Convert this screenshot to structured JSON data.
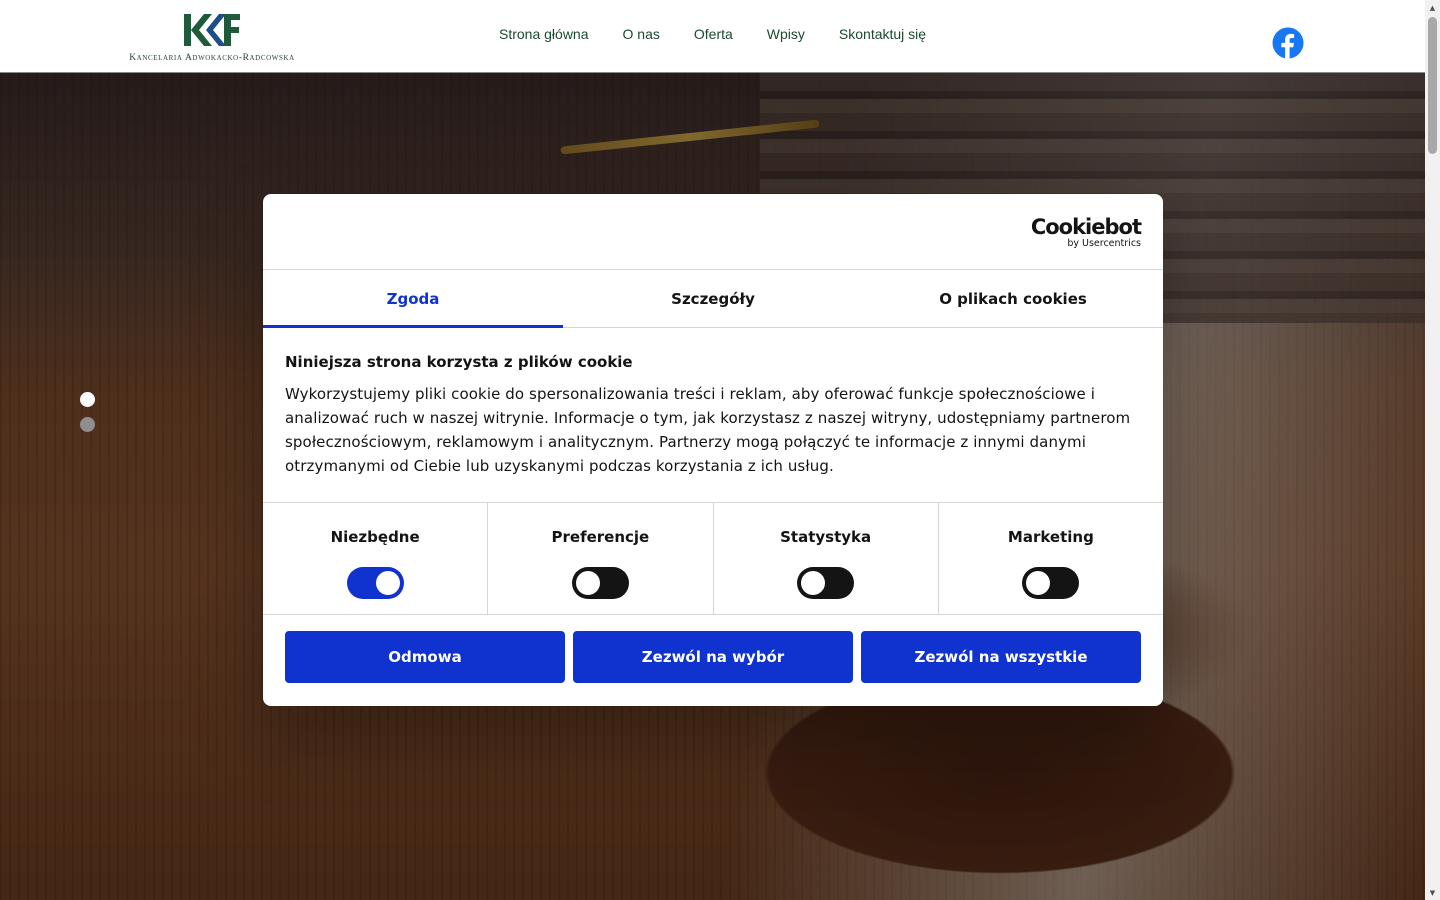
{
  "header": {
    "logo_initials": "KKF",
    "logo_subtitle": "Kancelaria Adwokacko-Radcowska",
    "nav": [
      {
        "label": "Strona główna"
      },
      {
        "label": "O nas"
      },
      {
        "label": "Oferta"
      },
      {
        "label": "Wpisy"
      },
      {
        "label": "Skontaktuj się"
      }
    ],
    "social_icon": "facebook-icon"
  },
  "hero": {
    "slides_count": 2,
    "active_slide": 1
  },
  "cookie_dialog": {
    "brand": "Cookiebot",
    "brand_by": "by Usercentrics",
    "tabs": [
      {
        "label": "Zgoda",
        "active": true
      },
      {
        "label": "Szczegóły",
        "active": false
      },
      {
        "label": "O plikach cookies",
        "active": false
      }
    ],
    "title": "Niniejsza strona korzysta z plików cookie",
    "text": "Wykorzystujemy pliki cookie do spersonalizowania treści i reklam, aby oferować funkcje społecznościowe i analizować ruch w naszej witrynie. Informacje o tym, jak korzystasz z naszej witryny, udostępniamy partnerom społecznościowym, reklamowym i analitycznym. Partnerzy mogą połączyć te informacje z innymi danymi otrzymanymi od Ciebie lub uzyskanymi podczas korzystania z ich usług.",
    "categories": [
      {
        "label": "Niezbędne",
        "enabled": true
      },
      {
        "label": "Preferencje",
        "enabled": false
      },
      {
        "label": "Statystyka",
        "enabled": false
      },
      {
        "label": "Marketing",
        "enabled": false
      }
    ],
    "buttons": {
      "deny": "Odmowa",
      "allow_selection": "Zezwól na wybór",
      "allow_all": "Zezwól na wszystkie"
    }
  },
  "colors": {
    "accent": "#1032cf",
    "nav_text": "#1d4a2e",
    "logo_green": "#1f5a3a",
    "logo_blue": "#1d4e8c",
    "facebook": "#1877f2"
  }
}
